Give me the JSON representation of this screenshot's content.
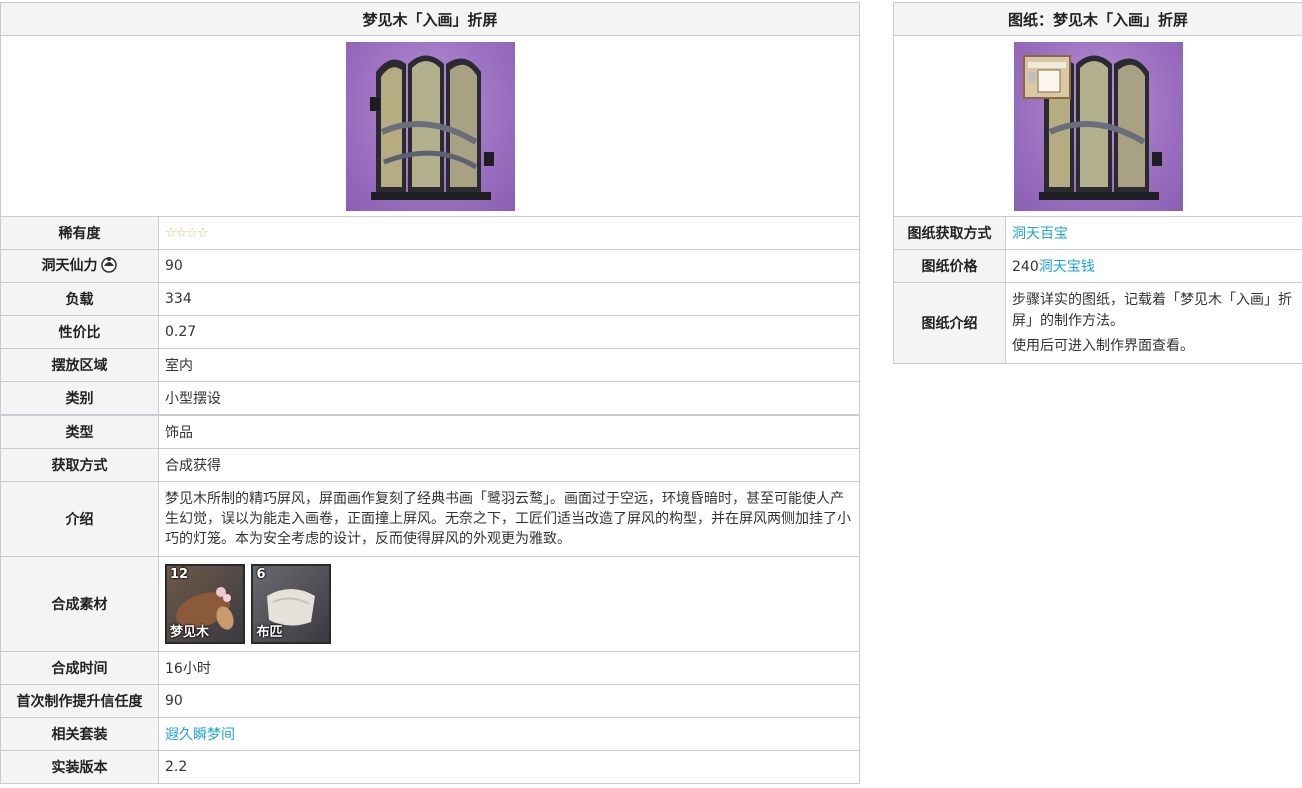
{
  "left": {
    "title": "梦见木「入画」折屏",
    "rows": [
      {
        "label": "稀有度",
        "value": "☆☆☆☆"
      },
      {
        "label": "洞天仙力",
        "value": "90"
      },
      {
        "label": "负载",
        "value": "334"
      },
      {
        "label": "性价比",
        "value": "0.27"
      },
      {
        "label": "摆放区域",
        "value": "室内"
      },
      {
        "label": "类别",
        "value": "小型摆设"
      },
      {
        "label": "类型",
        "value": "饰品"
      },
      {
        "label": "获取方式",
        "value": "合成获得"
      },
      {
        "label": "介绍",
        "value": "梦见木所制的精巧屏风，屏面画作复刻了经典书画「鹭羽云鹜」。画面过于空远，环境昏暗时，甚至可能使人产生幻觉，误以为能走入画卷，正面撞上屏风。无奈之下，工匠们适当改造了屏风的构型，并在屏风两侧加挂了小巧的灯笼。本为安全考虑的设计，反而使得屏风的外观更为雅致。"
      },
      {
        "label": "合成素材",
        "materials": [
          {
            "count": "12",
            "name": "梦见木"
          },
          {
            "count": "6",
            "name": "布匹"
          }
        ]
      },
      {
        "label": "合成时间",
        "value": "16小时"
      },
      {
        "label": "首次制作提升信任度",
        "value": "90"
      },
      {
        "label": "相关套装",
        "value": "遐久瞬梦间"
      },
      {
        "label": "实装版本",
        "value": "2.2"
      }
    ]
  },
  "right": {
    "title": "图纸：梦见木「入画」折屏",
    "rows": [
      {
        "label": "图纸获取方式",
        "value": "洞天百宝"
      },
      {
        "label": "图纸价格",
        "value_num": "240",
        "value_link": "洞天宝钱"
      },
      {
        "label": "图纸介绍",
        "value_1": "步骤详实的图纸，记载着「梦见木「入画」折屏」的制作方法。",
        "value_2": "使用后可进入制作界面查看。"
      }
    ]
  },
  "colors": {
    "link": "#1fa3d9",
    "header_bg": "#f4f4f4",
    "border": "#c8ccd1",
    "image_bg": "#9b70c0"
  },
  "icons": {
    "adeptal": "adeptal-energy-icon"
  }
}
